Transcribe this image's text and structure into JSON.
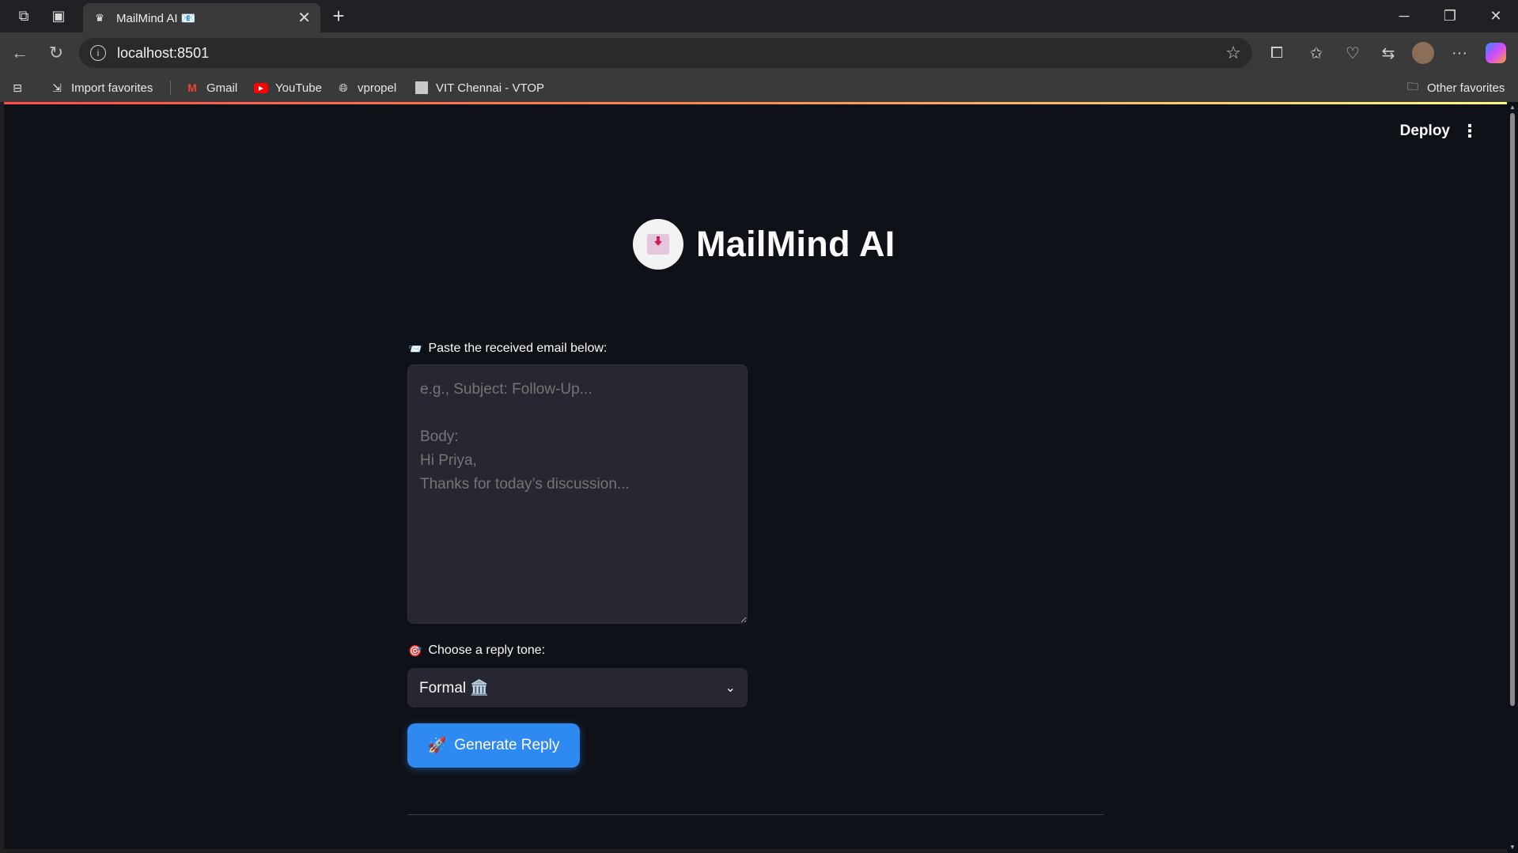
{
  "browser": {
    "tab_title": "MailMind AI 📧",
    "url": "localhost:8501",
    "bookmarks": {
      "import": "Import favorites",
      "gmail": "Gmail",
      "youtube": "YouTube",
      "vpropel": "vpropel",
      "vit": "VIT Chennai - VTOP",
      "other": "Other favorites"
    }
  },
  "app": {
    "deploy_label": "Deploy",
    "title": "MailMind AI",
    "email_label": "Paste the received email below:",
    "email_emoji": "📨",
    "email_placeholder": "e.g., Subject: Follow-Up...\n\nBody:\nHi Priya,\nThanks for today’s discussion...",
    "tone_label": "Choose a reply tone:",
    "tone_emoji": "🎯",
    "tone_value": "Formal 🏛️",
    "generate_label": "Generate Reply",
    "generate_emoji": "🚀"
  },
  "colors": {
    "page_bg": "#0e1117",
    "input_bg": "#262730",
    "button": "#2e89f0",
    "accent_red": "#ff4b4b"
  },
  "icons": [
    "workspaces-icon",
    "tab-actions-icon",
    "streamlit-crown-icon",
    "close-icon",
    "plus-icon",
    "minimize-icon",
    "restore-icon",
    "window-close-icon",
    "back-icon",
    "refresh-icon",
    "info-icon",
    "star-icon",
    "extensions-icon",
    "favorites-icon",
    "health-icon",
    "share-icon",
    "profile-avatar",
    "more-icon",
    "copilot-icon",
    "chevron-down-icon"
  ]
}
